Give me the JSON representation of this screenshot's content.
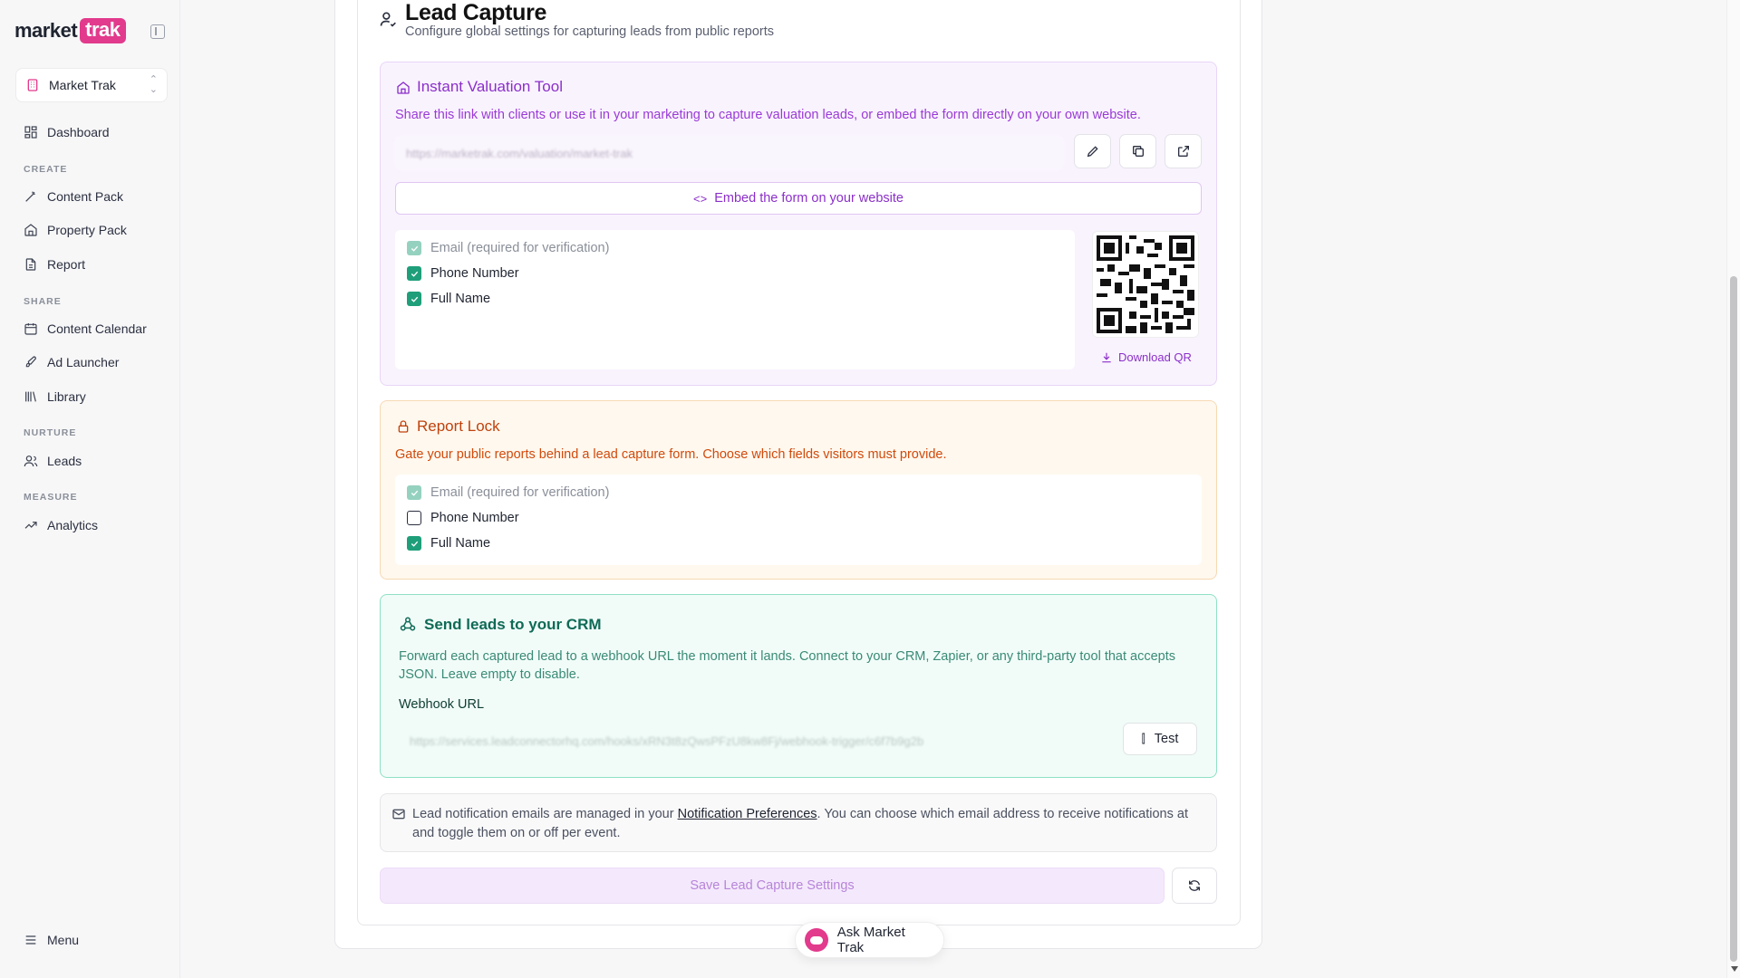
{
  "app": {
    "logo_word": "market",
    "logo_pill": "trak",
    "org_name": "Market Trak"
  },
  "sidebar": {
    "dashboard": "Dashboard",
    "sections": {
      "create": "CREATE",
      "share": "SHARE",
      "nurture": "NURTURE",
      "measure": "MEASURE"
    },
    "items": {
      "content_pack": "Content Pack",
      "property_pack": "Property Pack",
      "report": "Report",
      "content_calendar": "Content Calendar",
      "ad_launcher": "Ad Launcher",
      "library": "Library",
      "leads": "Leads",
      "analytics": "Analytics"
    },
    "menu": "Menu"
  },
  "header": {
    "title": "Lead Capture",
    "subtitle": "Configure global settings for capturing leads from public reports"
  },
  "ivt": {
    "title": "Instant Valuation Tool",
    "description": "Share this link with clients or use it in your marketing to capture valuation leads, or embed the form directly on your own website.",
    "url": "https://marketrak.com/valuation/market-trak",
    "embed_label": "Embed the form on your website",
    "fields": [
      {
        "label": "Email (required for verification)",
        "checked": true,
        "disabled": true
      },
      {
        "label": "Phone Number",
        "checked": true,
        "disabled": false
      },
      {
        "label": "Full Name",
        "checked": true,
        "disabled": false
      }
    ],
    "download_qr": "Download QR"
  },
  "report_lock": {
    "title": "Report Lock",
    "description": "Gate your public reports behind a lead capture form. Choose which fields visitors must provide.",
    "fields": [
      {
        "label": "Email (required for verification)",
        "checked": true,
        "disabled": true
      },
      {
        "label": "Phone Number",
        "checked": false,
        "disabled": false
      },
      {
        "label": "Full Name",
        "checked": true,
        "disabled": false
      }
    ]
  },
  "crm": {
    "title": "Send leads to your CRM",
    "description": "Forward each captured lead to a webhook URL the moment it lands. Connect to your CRM, Zapier, or any third-party tool that accepts JSON. Leave empty to disable.",
    "webhook_label": "Webhook URL",
    "webhook_value": "https://services.leadconnectorhq.com/hooks/xRN3t8zQwsPFzU8kw8Fj/webhook-trigger/c6f7b9g2b",
    "test_label": "Test"
  },
  "notification": {
    "text_before": "Lead notification emails are managed in your ",
    "link": "Notification Preferences",
    "text_after": ". You can choose which email address to receive notifications at and toggle them on or off per event."
  },
  "save_label": "Save Lead Capture Settings",
  "ask_label": "Ask Market Trak",
  "colors": {
    "accent": "#8b2fc9",
    "brand": "#e23a8c",
    "check": "#1f9e7a",
    "orange": "#d04a0c",
    "teal": "#0f6a56"
  }
}
